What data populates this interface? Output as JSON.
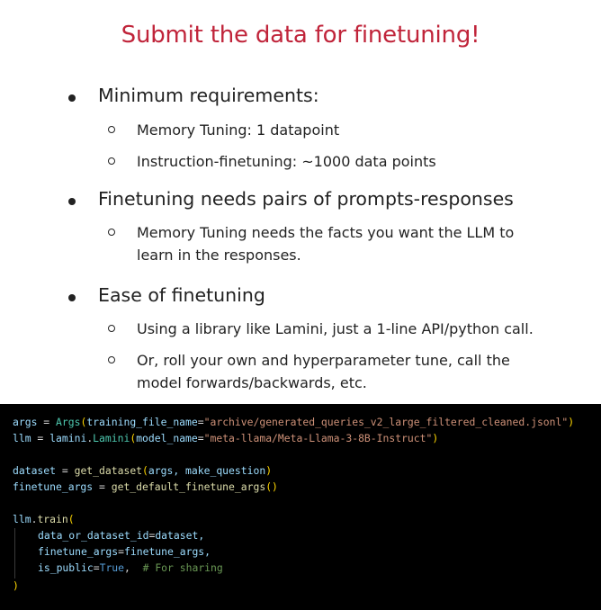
{
  "slide": {
    "title": "Submit the data for finetuning!",
    "bullets": [
      {
        "text": "Minimum requirements:",
        "sub": [
          "Memory Tuning: 1 datapoint",
          "Instruction-finetuning: ~1000 data points"
        ]
      },
      {
        "text": "Finetuning needs pairs of prompts-responses",
        "sub": [
          "Memory Tuning needs the facts you want the LLM to learn in the responses."
        ]
      },
      {
        "text": "Ease of finetuning",
        "sub": [
          "Using a library like Lamini, just a 1-line API/python call.",
          "Or, roll your own and hyperparameter tune, call the model forwards/backwards, etc."
        ]
      }
    ]
  },
  "code": {
    "l1": {
      "a": "args",
      "b": " = ",
      "c": "Args",
      "d": "(",
      "e": "training_file_name",
      "f": "=",
      "g": "\"archive/generated_queries_v2_large_filtered_cleaned.jsonl\"",
      "h": ")"
    },
    "l2": {
      "a": "llm",
      "b": " = ",
      "c": "lamini",
      "d": ".",
      "e": "Lamini",
      "f": "(",
      "g": "model_name",
      "h": "=",
      "i": "\"meta-llama/Meta-Llama-3-8B-Instruct\"",
      "j": ")"
    },
    "l3": {
      "a": "dataset",
      "b": " = ",
      "c": "get_dataset",
      "d": "(",
      "e": "args, make_question",
      "f": ")"
    },
    "l4": {
      "a": "finetune_args",
      "b": " = ",
      "c": "get_default_finetune_args",
      "d": "()"
    },
    "l5": {
      "a": "llm",
      "b": ".",
      "c": "train",
      "d": "("
    },
    "l6": {
      "a": "data_or_dataset_id",
      "b": "=",
      "c": "dataset,"
    },
    "l7": {
      "a": "finetune_args",
      "b": "=",
      "c": "finetune_args,"
    },
    "l8": {
      "a": "is_public",
      "b": "=",
      "c": "True",
      "d": ",  ",
      "e": "# For sharing"
    },
    "l9": {
      "a": ")"
    }
  }
}
